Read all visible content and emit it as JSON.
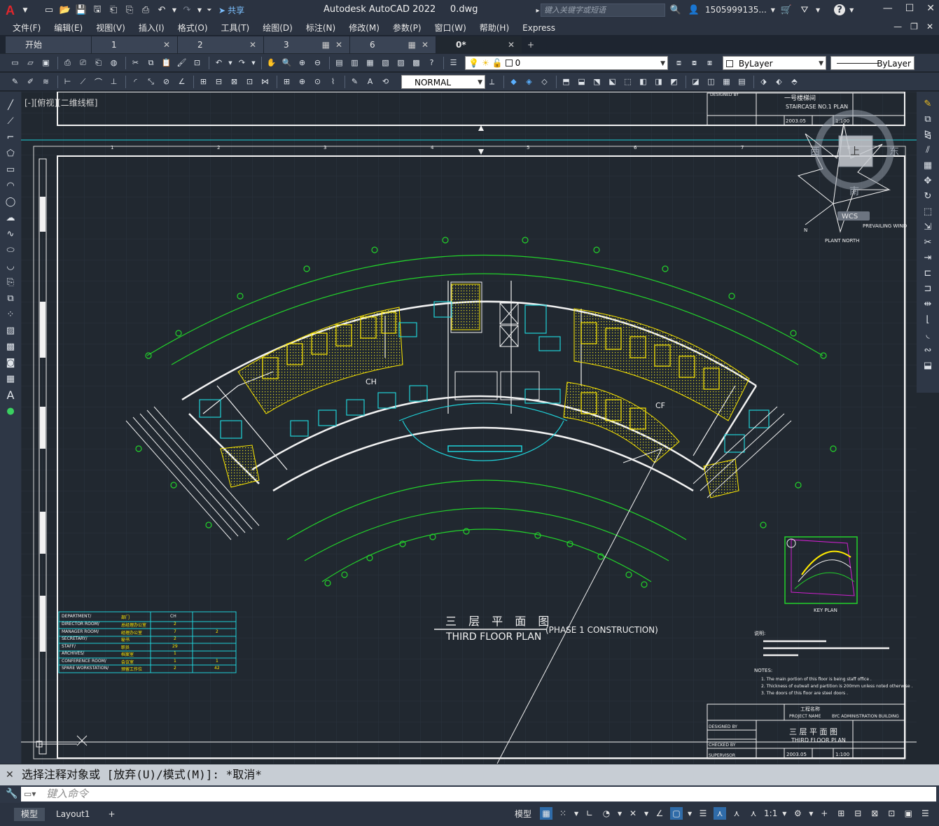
{
  "window": {
    "app_title": "Autodesk AutoCAD 2022",
    "file_name": "0.dwg",
    "search_placeholder": "键入关键字或短语",
    "user": "1505999135...",
    "share_label": "共享"
  },
  "menu": [
    "文件(F)",
    "编辑(E)",
    "视图(V)",
    "插入(I)",
    "格式(O)",
    "工具(T)",
    "绘图(D)",
    "标注(N)",
    "修改(M)",
    "参数(P)",
    "窗口(W)",
    "帮助(H)",
    "Express"
  ],
  "tabs": [
    {
      "label": "开始",
      "active": false
    },
    {
      "label": "1",
      "active": false
    },
    {
      "label": "2",
      "active": false
    },
    {
      "label": "3",
      "active": false
    },
    {
      "label": "6",
      "active": false
    },
    {
      "label": "0*",
      "active": true
    }
  ],
  "toolbar": {
    "layer_value": "0",
    "color_value": "ByLayer",
    "linetype_value": "ByLayer",
    "textstyle_value": "NORMAL"
  },
  "viewport": {
    "label": "[-][俯视][二维线框]",
    "viewcube": {
      "top": "上",
      "west": "西",
      "east": "东",
      "south": "南",
      "wcs": "WCS"
    }
  },
  "drawing": {
    "title_cn": "三 层 平 面 图",
    "title_en": "THIRD  FLOOR    PLAN",
    "phase": "(PHASE  1  CONSTRUCTION)",
    "top_titleblock": {
      "title_cn": "一号楼梯间",
      "title_en": "STAIRCASE NO.1 PLAN",
      "designed": "DESIGNED BY",
      "date": "2003.05",
      "scale": "1:100"
    },
    "bottom_titleblock": {
      "project_cn": "工程名称",
      "project_en": "PROJECT NAME",
      "building": "BYC  ADMINISTRATION  BUILDING",
      "title_cn": "三 层 平 面 图",
      "title_en": "THIRD FLOOR PLAN",
      "designed": "DESIGNED BY",
      "checked": "CHECKED BY",
      "supervisor": "SUPERVISOR",
      "date": "2003.05",
      "scale": "1:100"
    },
    "legend_rows": [
      [
        "DEPARTMENT/",
        "部门",
        "CH",
        ""
      ],
      [
        "DIRECTOR ROOM/",
        "总经理办公室",
        "2",
        ""
      ],
      [
        "MANAGER ROOM/",
        "经理办公室",
        "7",
        "2"
      ],
      [
        "SECRETARY/",
        "秘书",
        "2",
        ""
      ],
      [
        "STAFF/",
        "职员",
        "29",
        ""
      ],
      [
        "ARCHIVES/",
        "档案室",
        "1",
        ""
      ],
      [
        "CONFERENCE ROOM/",
        "会议室",
        "1",
        "1"
      ],
      [
        "SPARE WORKSTATION/",
        "预留工作位",
        "2",
        "42"
      ]
    ],
    "zone_labels": [
      "CH",
      "CF"
    ],
    "key_plan": "KEY PLAN",
    "north_labels": [
      "PLANT NORTH",
      "PREVAILING WIND",
      "N"
    ],
    "notes_title": "说明:",
    "notes_en_title": "NOTES:",
    "notes": [
      "1. The main portion of this floor is being staff office .",
      "2. Thickness of outwall and partition is 200mm unless noted otherwise .",
      "3. The doors of this floor are steel doors ."
    ]
  },
  "command": {
    "history": "选择注释对象或 [放弃(U)/模式(M)]: *取消*",
    "placeholder": "键入命令"
  },
  "status": {
    "model_tab": "模型",
    "layout_tab": "Layout1",
    "model_label": "模型",
    "scale": "1:1"
  },
  "colors": {
    "background": "#212830",
    "green": "#22d32a",
    "cyan": "#1fd1d8",
    "yellow": "#ffea00",
    "white": "#f2f2f2"
  }
}
